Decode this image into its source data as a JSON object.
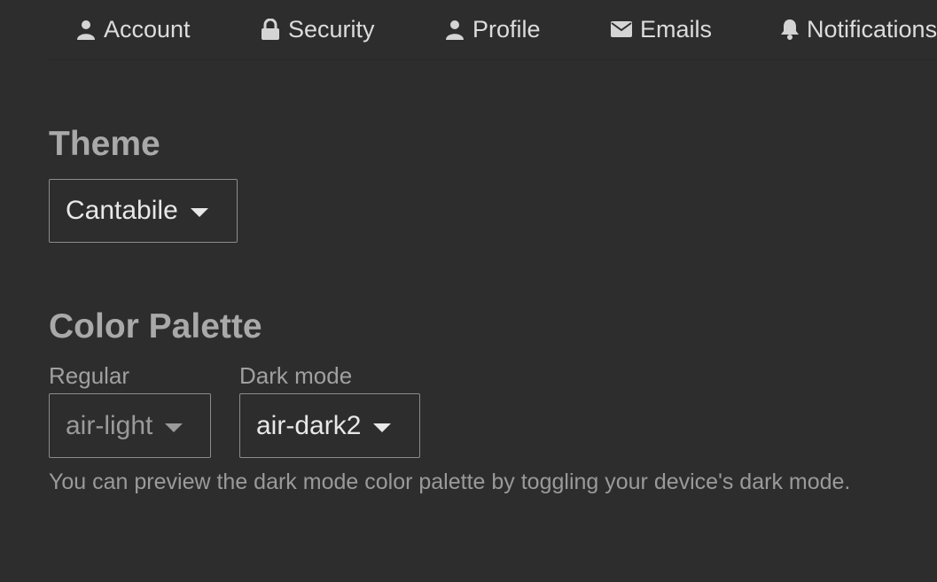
{
  "tabs": [
    {
      "label": "Account",
      "icon": "user-icon"
    },
    {
      "label": "Security",
      "icon": "lock-icon"
    },
    {
      "label": "Profile",
      "icon": "user-icon"
    },
    {
      "label": "Emails",
      "icon": "envelope-icon"
    },
    {
      "label": "Notifications",
      "icon": "bell-icon"
    }
  ],
  "theme": {
    "heading": "Theme",
    "selected": "Cantabile"
  },
  "color_palette": {
    "heading": "Color Palette",
    "regular": {
      "label": "Regular",
      "selected": "air-light"
    },
    "dark_mode": {
      "label": "Dark mode",
      "selected": "air-dark2"
    },
    "help_text": "You can preview the dark mode color palette by toggling your device's dark mode."
  },
  "colors": {
    "background": "#2d2d2d",
    "text": "#e8e8e8",
    "muted": "#a9a9a9",
    "border": "#8c8c8c"
  }
}
